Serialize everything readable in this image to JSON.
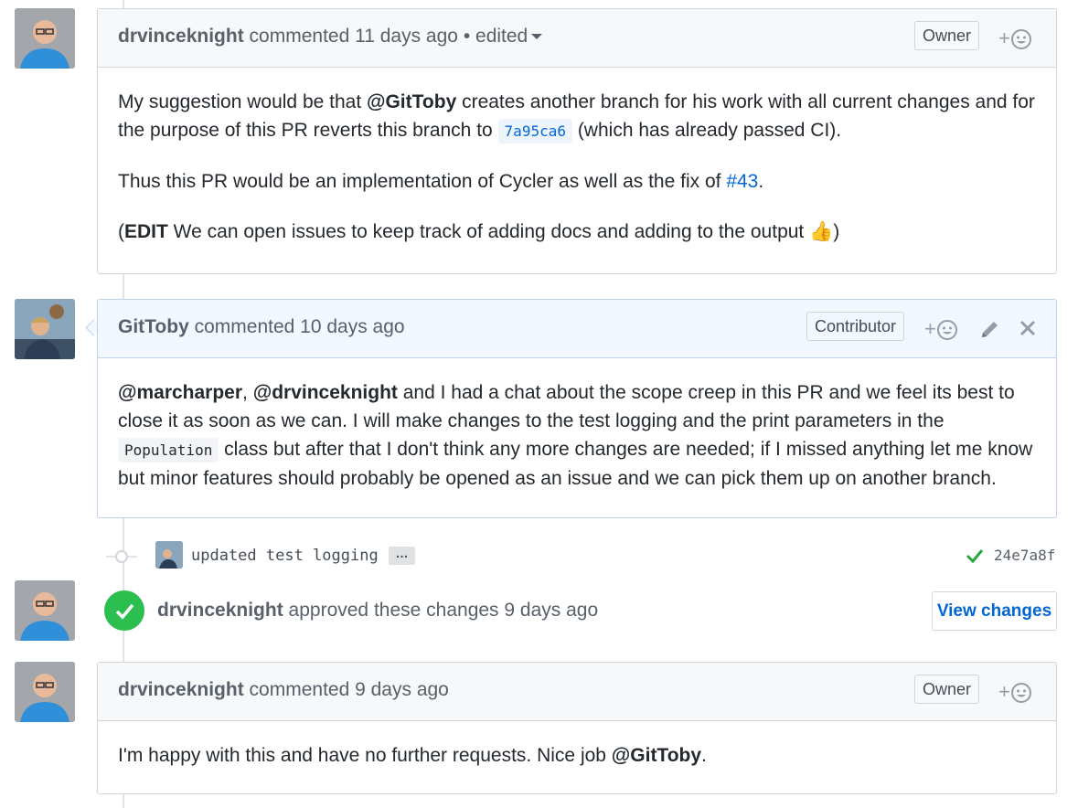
{
  "comments": [
    {
      "author": "drvinceknight",
      "action": "commented",
      "time": "11 days ago",
      "edited": "• edited",
      "role": "Owner",
      "reaction": "+",
      "paragraphs": {
        "p1_a": "My suggestion would be that ",
        "p1_mention": "@GitToby",
        "p1_b": " creates another branch for his work with all current changes and for the purpose of this PR reverts this branch to ",
        "p1_code": "7a95ca6",
        "p1_c": " (which has already passed CI).",
        "p2_a": "Thus this PR would be an implementation of Cycler as well as the fix of ",
        "p2_link": "#43",
        "p2_b": ".",
        "p3_a": "(",
        "p3_bold": "EDIT",
        "p3_b": " We can open issues to keep track of adding docs and adding to the output ",
        "p3_emoji": "👍",
        "p3_c": ")"
      }
    },
    {
      "author": "GitToby",
      "action": "commented",
      "time": "10 days ago",
      "role": "Contributor",
      "reaction": "+",
      "paragraphs": {
        "m1": "@marcharper",
        "sep": ", ",
        "m2": "@drvinceknight",
        "a": " and I had a chat about the scope creep in this PR and we feel its best to close it as soon as we can. I will make changes to the test logging and the print parameters in the ",
        "code": "Population",
        "b": " class but after that I don't think any more changes are needed; if I missed anything let me know but minor features should probably be opened as an issue and we can pick them up on another branch."
      }
    },
    {
      "author": "drvinceknight",
      "action": "commented",
      "time": "9 days ago",
      "role": "Owner",
      "reaction": "+",
      "paragraphs": {
        "a": "I'm happy with this and have no further requests. Nice job ",
        "mention": "@GitToby",
        "b": "."
      }
    }
  ],
  "commit": {
    "message": "updated test logging",
    "ellipsis": "…",
    "sha": "24e7a8f",
    "status": "success"
  },
  "review": {
    "author": "drvinceknight",
    "text": "approved these changes",
    "time": "9 days ago",
    "button": "View changes"
  },
  "colors": {
    "link": "#0366d6",
    "success": "#2cbe4e",
    "header_bg": "#f6f8fa",
    "header_blue_bg": "#f1f8ff"
  }
}
